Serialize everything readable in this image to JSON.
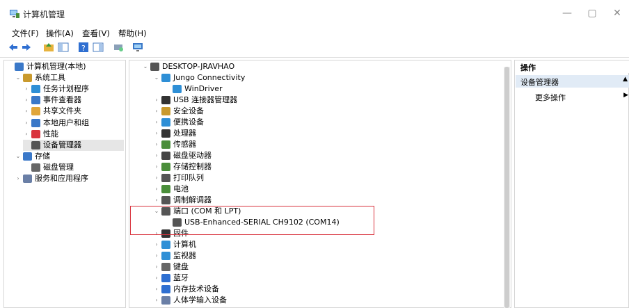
{
  "window": {
    "title": "计算机管理",
    "minimize": "—",
    "maximize": "▢",
    "close": "✕"
  },
  "menu": [
    "文件(F)",
    "操作(A)",
    "查看(V)",
    "帮助(H)"
  ],
  "left_tree": [
    {
      "label": "计算机管理(本地)",
      "icon": "computer-mgmt-icon",
      "level": 0,
      "chev": ""
    },
    {
      "label": "系统工具",
      "icon": "tools-icon",
      "level": 1,
      "chev": "⌄"
    },
    {
      "label": "任务计划程序",
      "icon": "clock-icon",
      "level": 2,
      "chev": "›"
    },
    {
      "label": "事件查看器",
      "icon": "event-viewer-icon",
      "level": 2,
      "chev": "›"
    },
    {
      "label": "共享文件夹",
      "icon": "shared-folder-icon",
      "level": 2,
      "chev": "›"
    },
    {
      "label": "本地用户和组",
      "icon": "users-icon",
      "level": 2,
      "chev": "›"
    },
    {
      "label": "性能",
      "icon": "performance-icon",
      "level": 2,
      "chev": "›"
    },
    {
      "label": "设备管理器",
      "icon": "device-manager-icon",
      "level": 2,
      "chev": "",
      "selected": true
    },
    {
      "label": "存储",
      "icon": "storage-icon",
      "level": 1,
      "chev": "⌄"
    },
    {
      "label": "磁盘管理",
      "icon": "disk-mgmt-icon",
      "level": 2,
      "chev": ""
    },
    {
      "label": "服务和应用程序",
      "icon": "services-icon",
      "level": 1,
      "chev": "›"
    }
  ],
  "device_tree": [
    {
      "label": "DESKTOP-JRAVHAO",
      "icon": "computer-icon",
      "level": 0,
      "chev": "⌄"
    },
    {
      "label": "Jungo Connectivity",
      "icon": "jungo-icon",
      "level": 1,
      "chev": "⌄"
    },
    {
      "label": "WinDriver",
      "icon": "windriver-icon",
      "level": 2,
      "chev": ""
    },
    {
      "label": "USB 连接器管理器",
      "icon": "usb-icon",
      "level": 1,
      "chev": "›"
    },
    {
      "label": "安全设备",
      "icon": "security-device-icon",
      "level": 1,
      "chev": "›"
    },
    {
      "label": "便携设备",
      "icon": "portable-device-icon",
      "level": 1,
      "chev": "›"
    },
    {
      "label": "处理器",
      "icon": "processor-icon",
      "level": 1,
      "chev": "›"
    },
    {
      "label": "传感器",
      "icon": "sensor-icon",
      "level": 1,
      "chev": "›"
    },
    {
      "label": "磁盘驱动器",
      "icon": "disk-drive-icon",
      "level": 1,
      "chev": "›"
    },
    {
      "label": "存储控制器",
      "icon": "storage-controller-icon",
      "level": 1,
      "chev": "›"
    },
    {
      "label": "打印队列",
      "icon": "printer-icon",
      "level": 1,
      "chev": "›"
    },
    {
      "label": "电池",
      "icon": "battery-icon",
      "level": 1,
      "chev": "›"
    },
    {
      "label": "调制解调器",
      "icon": "modem-icon",
      "level": 1,
      "chev": "›"
    },
    {
      "label": "端口 (COM 和 LPT)",
      "icon": "port-icon",
      "level": 1,
      "chev": "⌄"
    },
    {
      "label": "USB-Enhanced-SERIAL CH9102 (COM14)",
      "icon": "port-device-icon",
      "level": 2,
      "chev": ""
    },
    {
      "label": "固件",
      "icon": "firmware-icon",
      "level": 1,
      "chev": "›"
    },
    {
      "label": "计算机",
      "icon": "computer-node-icon",
      "level": 1,
      "chev": "›"
    },
    {
      "label": "监视器",
      "icon": "monitor-icon",
      "level": 1,
      "chev": "›"
    },
    {
      "label": "键盘",
      "icon": "keyboard-icon",
      "level": 1,
      "chev": "›"
    },
    {
      "label": "蓝牙",
      "icon": "bluetooth-icon",
      "level": 1,
      "chev": "›"
    },
    {
      "label": "内存技术设备",
      "icon": "memory-icon",
      "level": 1,
      "chev": "›"
    },
    {
      "label": "人体学输入设备",
      "icon": "hid-icon",
      "level": 1,
      "chev": "›"
    }
  ],
  "actions": {
    "header": "操作",
    "section": "设备管理器",
    "more": "更多操作"
  },
  "colors": {
    "highlight_box": "#d9333d",
    "selection": "#e1ebf6",
    "accent": "#2f6fd1"
  }
}
